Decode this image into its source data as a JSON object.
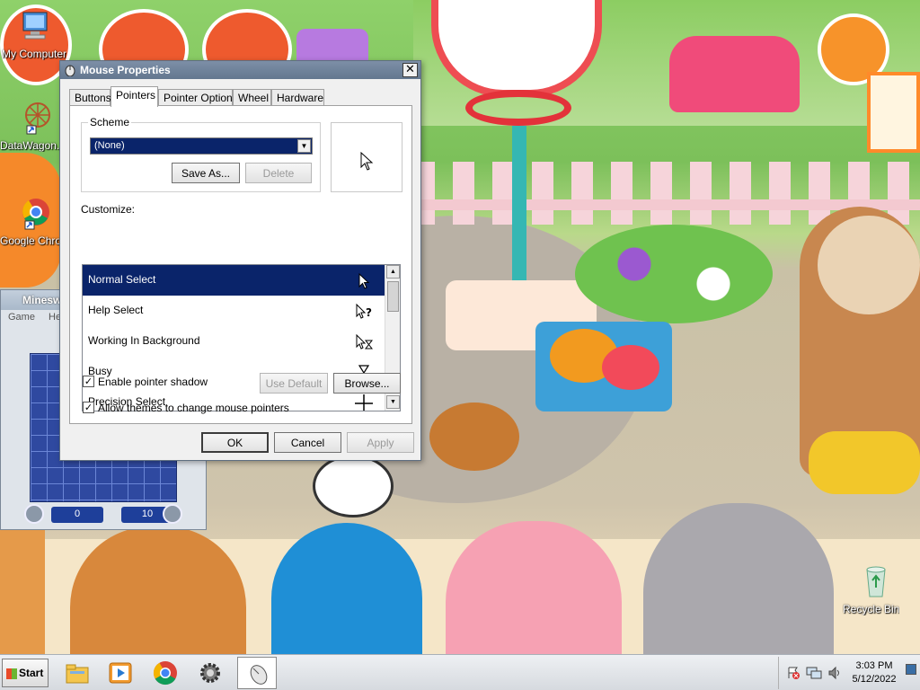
{
  "desktop": {
    "icons": [
      {
        "label": "My Computer"
      },
      {
        "label": "DataWagon."
      },
      {
        "label": "Google Chrom"
      },
      {
        "label": "Recycle Bin"
      }
    ]
  },
  "minesweeper": {
    "title": "Minesw",
    "menu": [
      "Game",
      "Help"
    ],
    "time_counter": "0",
    "mines_counter": "10"
  },
  "dialog": {
    "title": "Mouse Properties",
    "close_symbol": "✕",
    "tabs": [
      {
        "label": "Buttons",
        "active": false
      },
      {
        "label": "Pointers",
        "active": true
      },
      {
        "label": "Pointer Options",
        "active": false
      },
      {
        "label": "Wheel",
        "active": false
      },
      {
        "label": "Hardware",
        "active": false
      }
    ],
    "scheme": {
      "group_label": "Scheme",
      "selected": "(None)",
      "save_as_label": "Save As...",
      "delete_label": "Delete"
    },
    "customize_label": "Customize:",
    "pointers": [
      {
        "label": "Normal Select",
        "icon": "arrow-cursor-icon",
        "selected": true
      },
      {
        "label": "Help Select",
        "icon": "help-cursor-icon",
        "selected": false
      },
      {
        "label": "Working In Background",
        "icon": "working-cursor-icon",
        "selected": false
      },
      {
        "label": "Busy",
        "icon": "hourglass-cursor-icon",
        "selected": false
      },
      {
        "label": "Precision Select",
        "icon": "crosshair-cursor-icon",
        "selected": false
      }
    ],
    "enable_shadow_label": "Enable pointer shadow",
    "enable_shadow_checked": true,
    "use_default_label": "Use Default",
    "browse_label": "Browse...",
    "allow_themes_label": "Allow themes to change mouse pointers",
    "allow_themes_checked": true,
    "ok_label": "OK",
    "cancel_label": "Cancel",
    "apply_label": "Apply"
  },
  "taskbar": {
    "start_label": "Start",
    "apps": [
      "file-explorer-icon",
      "media-player-icon",
      "chrome-icon",
      "settings-gear-icon",
      "mouse-icon"
    ],
    "time": "3:03 PM",
    "date": "5/12/2022"
  },
  "colors": {
    "selection": "#0a246a",
    "titlebar": "#6f8299",
    "dialog_bg": "#f0f0f0"
  }
}
